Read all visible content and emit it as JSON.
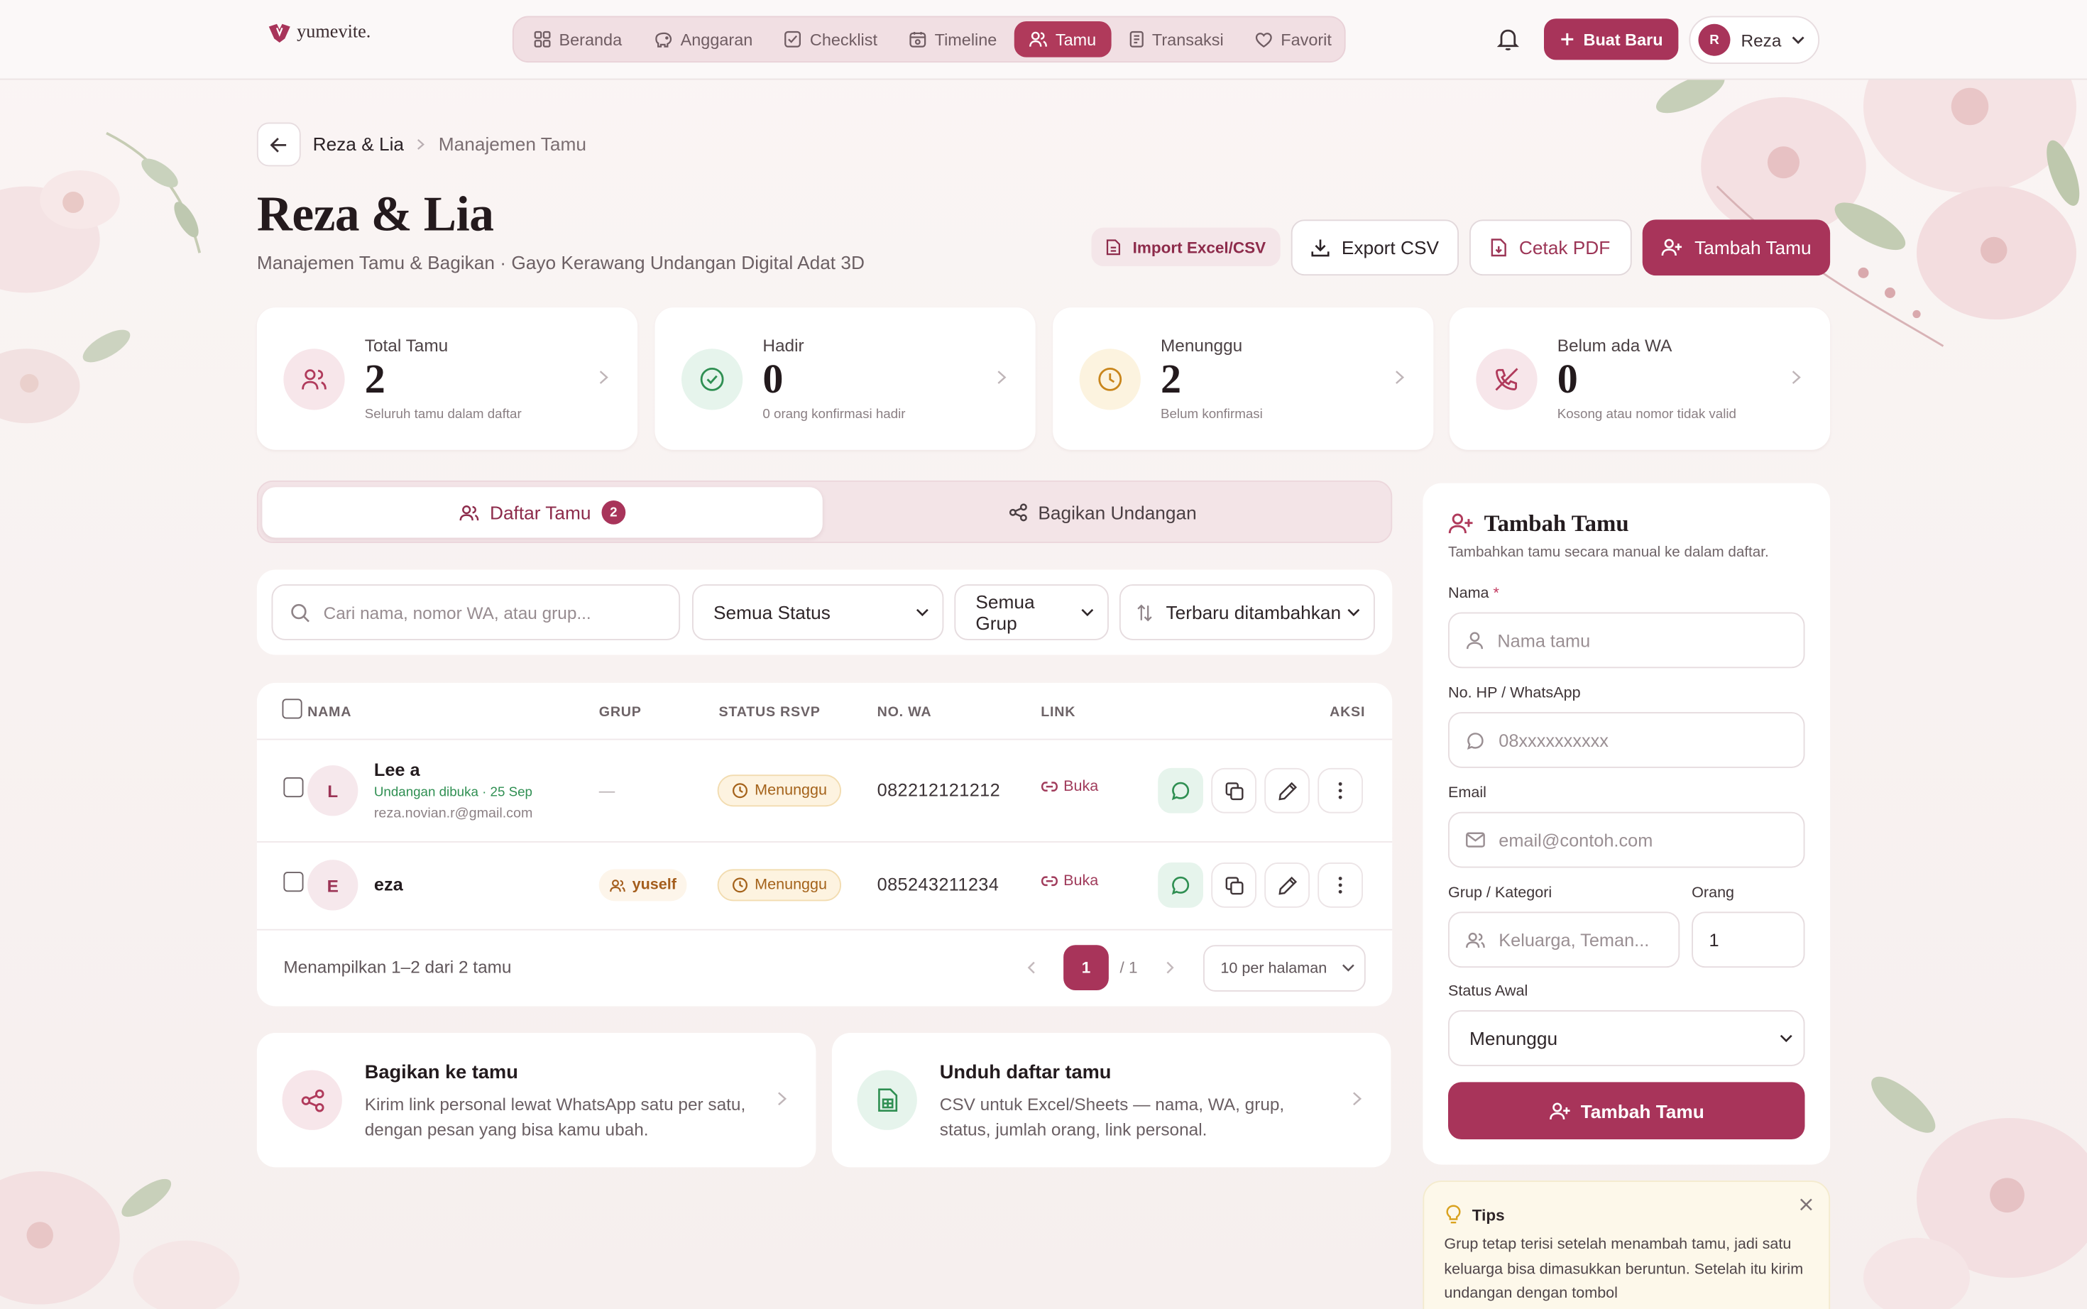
{
  "app": {
    "brand": "yumevite."
  },
  "nav": {
    "items": [
      {
        "label": "Beranda",
        "icon": "grid-icon"
      },
      {
        "label": "Anggaran",
        "icon": "piggy-bank-icon"
      },
      {
        "label": "Checklist",
        "icon": "checkbox-icon"
      },
      {
        "label": "Timeline",
        "icon": "calendar-icon"
      },
      {
        "label": "Tamu",
        "icon": "users-icon",
        "active": true
      },
      {
        "label": "Transaksi",
        "icon": "receipt-icon"
      },
      {
        "label": "Favorit",
        "icon": "heart-icon"
      }
    ],
    "new_button": "Buat Baru",
    "user": {
      "initial": "R",
      "name": "Reza"
    }
  },
  "breadcrumb": {
    "first": "Reza & Lia",
    "current": "Manajemen Tamu"
  },
  "header": {
    "title": "Reza & Lia",
    "subtitle": "Manajemen Tamu & Bagikan · Gayo Kerawang Undangan Digital Adat 3D",
    "import_label": "Import Excel/CSV",
    "export_label": "Export CSV",
    "pdf_label": "Cetak PDF",
    "add_label": "Tambah Tamu"
  },
  "stats": [
    {
      "label": "Total Tamu",
      "value": "2",
      "note": "Seluruh tamu dalam daftar",
      "icon": "users-icon",
      "color": "#b03a5b",
      "bg": "#f7e6ea"
    },
    {
      "label": "Hadir",
      "value": "0",
      "note": "0 orang konfirmasi hadir",
      "icon": "check-circle-icon",
      "color": "#2f8f52",
      "bg": "#e6f4ec"
    },
    {
      "label": "Menunggu",
      "value": "2",
      "note": "Belum konfirmasi",
      "icon": "clock-icon",
      "color": "#c9861c",
      "bg": "#fcf3df"
    },
    {
      "label": "Belum ada WA",
      "value": "0",
      "note": "Kosong atau nomor tidak valid",
      "icon": "phone-off-icon",
      "color": "#b03a5b",
      "bg": "#f7e6ea"
    }
  ],
  "tabs": {
    "list_label": "Daftar Tamu",
    "list_count": "2",
    "share_label": "Bagikan Undangan"
  },
  "filters": {
    "search_placeholder": "Cari nama, nomor WA, atau grup...",
    "status": "Semua Status",
    "group": "Semua Grup",
    "sort": "Terbaru ditambahkan"
  },
  "table": {
    "headers": {
      "name": "NAMA",
      "group": "GRUP",
      "status": "STATUS RSVP",
      "wa": "NO. WA",
      "link": "LINK",
      "action": "AKSI"
    },
    "rows": [
      {
        "initial": "L",
        "name": "Lee a",
        "sub": "Undangan dibuka · 25 Sep",
        "email": "reza.novian.r@gmail.com",
        "group": "—",
        "status": "Menunggu",
        "wa": "082212121212",
        "link": "Buka"
      },
      {
        "initial": "E",
        "name": "eza",
        "sub": "",
        "email": "",
        "group": "yuself",
        "status": "Menunggu",
        "wa": "085243211234",
        "link": "Buka"
      }
    ],
    "footer": "Menampilkan 1–2 dari 2 tamu",
    "page": "1",
    "page_total": "/ 1",
    "per_page": "10 per halaman"
  },
  "cards": [
    {
      "title": "Bagikan ke tamu",
      "desc": "Kirim link personal lewat WhatsApp satu per satu, dengan pesan yang bisa kamu ubah.",
      "icon": "share-icon"
    },
    {
      "title": "Unduh daftar tamu",
      "desc": "CSV untuk Excel/Sheets — nama, WA, grup, status, jumlah orang, link personal.",
      "icon": "file-sheet-icon"
    }
  ],
  "form": {
    "title": "Tambah Tamu",
    "desc": "Tambahkan tamu secara manual ke dalam daftar.",
    "name_label": "Nama",
    "name_required": "*",
    "name_placeholder": "Nama tamu",
    "phone_label": "No. HP / WhatsApp",
    "phone_placeholder": "08xxxxxxxxxx",
    "email_label": "Email",
    "email_placeholder": "email@contoh.com",
    "group_label": "Grup / Kategori",
    "group_placeholder": "Keluarga, Teman...",
    "count_label": "Orang",
    "count_value": "1",
    "status_label": "Status Awal",
    "status_value": "Menunggu",
    "submit": "Tambah Tamu"
  },
  "tips": {
    "title": "Tips",
    "body": "Grup tetap terisi setelah menambah tamu, jadi satu keluarga bisa dimasukkan beruntun. Setelah itu kirim undangan dengan tombol"
  }
}
